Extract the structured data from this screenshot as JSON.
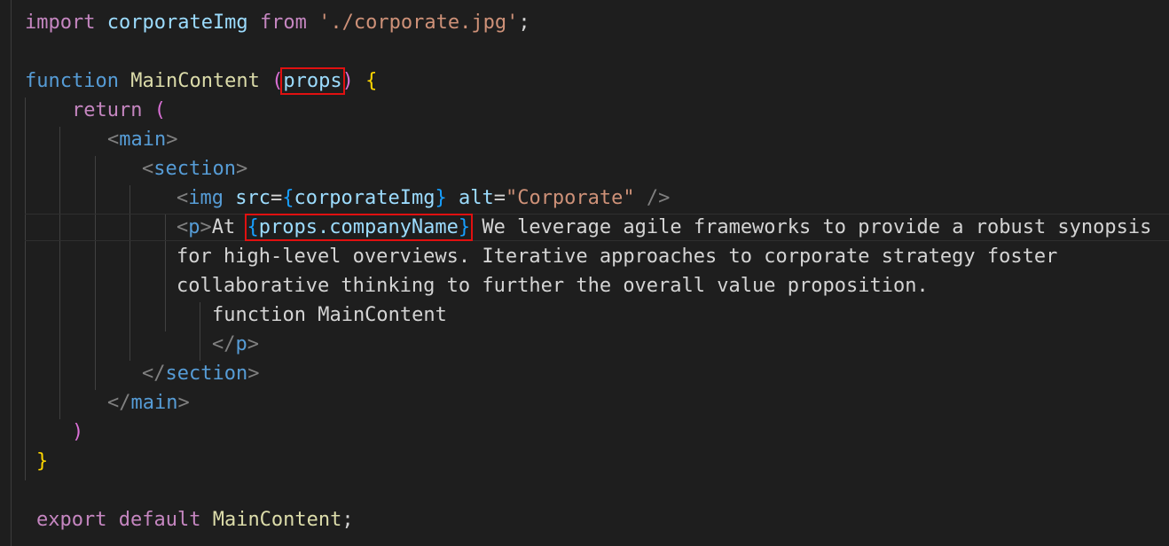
{
  "code": {
    "line1": {
      "kw_import": "import",
      "ident": "corporateImg",
      "kw_from": "from",
      "path": "'./corporate.jpg'",
      "semi": ";"
    },
    "line3": {
      "kw_function": "function",
      "name": "MainContent",
      "open_paren": "(",
      "param": "props",
      "close_paren": ")",
      "open_brace": "{"
    },
    "line4": {
      "kw_return": "return",
      "paren": "("
    },
    "line5": {
      "lt": "<",
      "tag": "main",
      "gt": ">"
    },
    "line6": {
      "lt": "<",
      "tag": "section",
      "gt": ">"
    },
    "line7": {
      "lt": "<",
      "tag": "img",
      "attr_src": "src",
      "eq1": "=",
      "ob": "{",
      "src_val": "corporateImg",
      "cb": "}",
      "attr_alt": "alt",
      "eq2": "=",
      "alt_val": "\"Corporate\"",
      "close": "/>"
    },
    "line8": {
      "lt": "<",
      "tag": "p",
      "gt": ">",
      "text_at": "At",
      "ob": "{",
      "expr": "props.companyName",
      "cb": "}",
      "text_rest": "We leverage agile frameworks to provide a robust synopsis"
    },
    "line9": {
      "text": "for high-level overviews. Iterative approaches to corporate strategy foster"
    },
    "line10": {
      "text": "collaborative thinking to further the overall value proposition."
    },
    "line11": {
      "text": "function MainContent"
    },
    "line12": {
      "lt": "</",
      "tag": "p",
      "gt": ">"
    },
    "line13": {
      "lt": "</",
      "tag": "section",
      "gt": ">"
    },
    "line14": {
      "lt": "</",
      "tag": "main",
      "gt": ">"
    },
    "line15": {
      "paren": ")"
    },
    "line16": {
      "brace": "}"
    },
    "line18": {
      "kw_export": "export",
      "kw_default": "default",
      "name": "MainContent",
      "semi": ";"
    }
  },
  "colors": {
    "background": "#1e1e1e",
    "keyword_control": "#c586c0",
    "keyword_storage": "#569cd6",
    "function_name": "#dcdcaa",
    "variable": "#9cdcfe",
    "string": "#ce9178",
    "highlight_box": "#e01010"
  }
}
